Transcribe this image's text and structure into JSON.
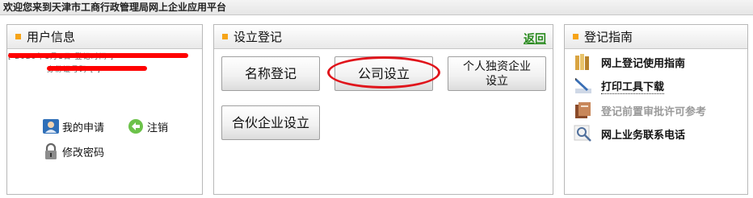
{
  "header": {
    "welcome": "欢迎您来到天津市工商行政管理局网上企业应用平台"
  },
  "user_panel": {
    "title": "用户信息",
    "redacted_line1": "[ 2020年1月1日 登记时间 ]",
    "redacted_line2": "身份证号码 [ ]",
    "my_application": "我的申请",
    "logout": "注销",
    "change_password": "修改密码"
  },
  "reg_panel": {
    "title": "设立登记",
    "back": "返回",
    "btn_name": "名称登记",
    "btn_company": "公司设立",
    "btn_sole_line1": "个人独资企业",
    "btn_sole_line2": "设立",
    "btn_partnership": "合伙企业设立"
  },
  "guide_panel": {
    "title": "登记指南",
    "items": [
      {
        "label": "网上登记使用指南"
      },
      {
        "label": "打印工具下载"
      },
      {
        "label": "登记前置审批许可参考"
      },
      {
        "label": "网上业务联系电话"
      }
    ]
  },
  "colors": {
    "accent_bullet": "#f6a418",
    "back_link": "#2a8a1f",
    "highlight": "#e0141b"
  }
}
